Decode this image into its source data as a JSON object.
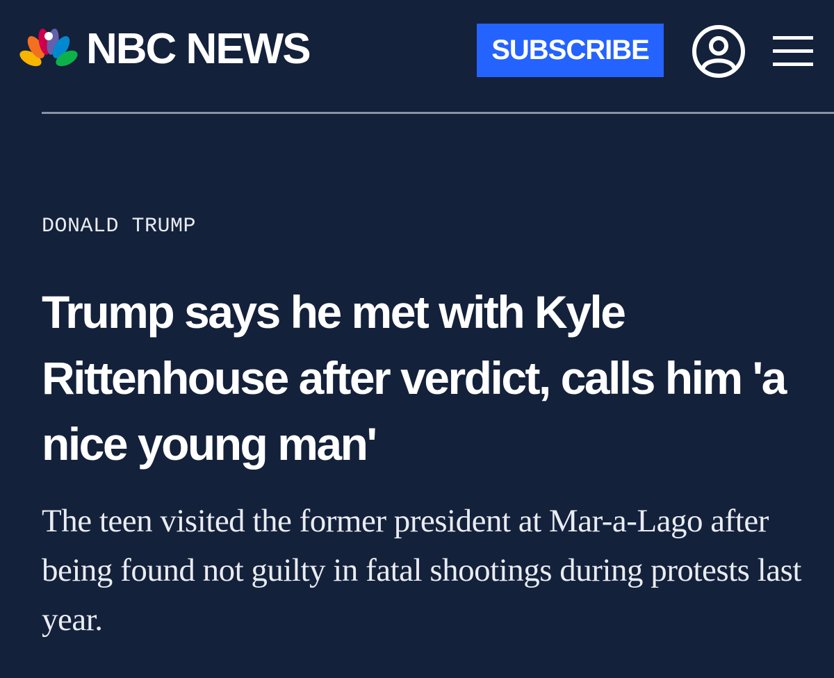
{
  "header": {
    "logo_text": "NBC NEWS",
    "subscribe_label": "SUBSCRIBE",
    "icons": [
      "nbc-peacock-logo",
      "account-icon",
      "hamburger-menu-icon"
    ]
  },
  "article": {
    "section": "DONALD TRUMP",
    "headline": "Trump says he met with Kyle Rittenhouse after verdict, calls him 'a nice young man'",
    "dek": "The teen visited the former president at Mar-a-Lago after being found not guilty in fatal shootings during protests last year."
  },
  "colors": {
    "background": "#14213b",
    "subscribe_button": "#2563ff",
    "text": "#ffffff",
    "divider": "#8a93a6"
  }
}
